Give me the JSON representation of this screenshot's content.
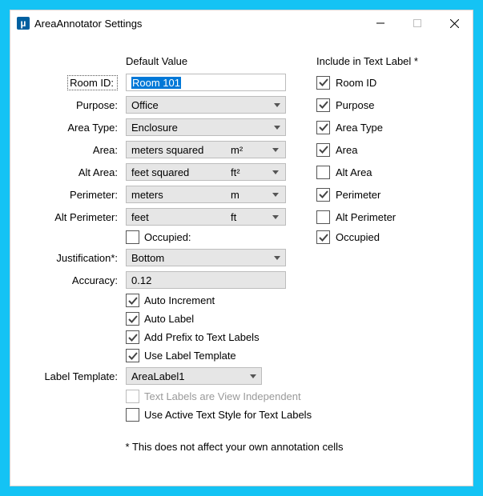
{
  "window": {
    "title": "AreaAnnotator Settings",
    "icon_glyph": "µ"
  },
  "headers": {
    "default_value": "Default Value",
    "include_in_label": "Include in Text Label *"
  },
  "labels": {
    "room_id": "Room ID:",
    "purpose": "Purpose:",
    "area_type": "Area Type:",
    "area": "Area:",
    "alt_area": "Alt Area:",
    "perimeter": "Perimeter:",
    "alt_perimeter": "Alt Perimeter:",
    "occupied": "Occupied:",
    "justification": "Justification*:",
    "accuracy": "Accuracy:",
    "auto_increment": "Auto Increment",
    "auto_label": "Auto Label",
    "add_prefix": "Add Prefix to Text Labels",
    "use_template": "Use Label Template",
    "label_template": "Label Template:",
    "view_independent": "Text Labels are View Independent",
    "active_text_style": "Use Active Text Style for Text Labels"
  },
  "values": {
    "room_id": "Room 101",
    "purpose": "Office",
    "area_type": "Enclosure",
    "area_unit_name": "meters squared",
    "area_unit_abbr": "m²",
    "alt_area_unit_name": "feet squared",
    "alt_area_unit_abbr": "ft²",
    "perimeter_unit_name": "meters",
    "perimeter_unit_abbr": "m",
    "alt_perimeter_unit_name": "feet",
    "alt_perimeter_unit_abbr": "ft",
    "justification": "Bottom",
    "accuracy": "0.12",
    "label_template": "AreaLabel1"
  },
  "include": {
    "room_id_label": "Room ID",
    "purpose_label": "Purpose",
    "area_type_label": "Area Type",
    "area_label": "Area",
    "alt_area_label": "Alt Area",
    "perimeter_label": "Perimeter",
    "alt_perimeter_label": "Alt Perimeter",
    "occupied_label": "Occupied"
  },
  "footer": "* This does not affect your own annotation cells"
}
